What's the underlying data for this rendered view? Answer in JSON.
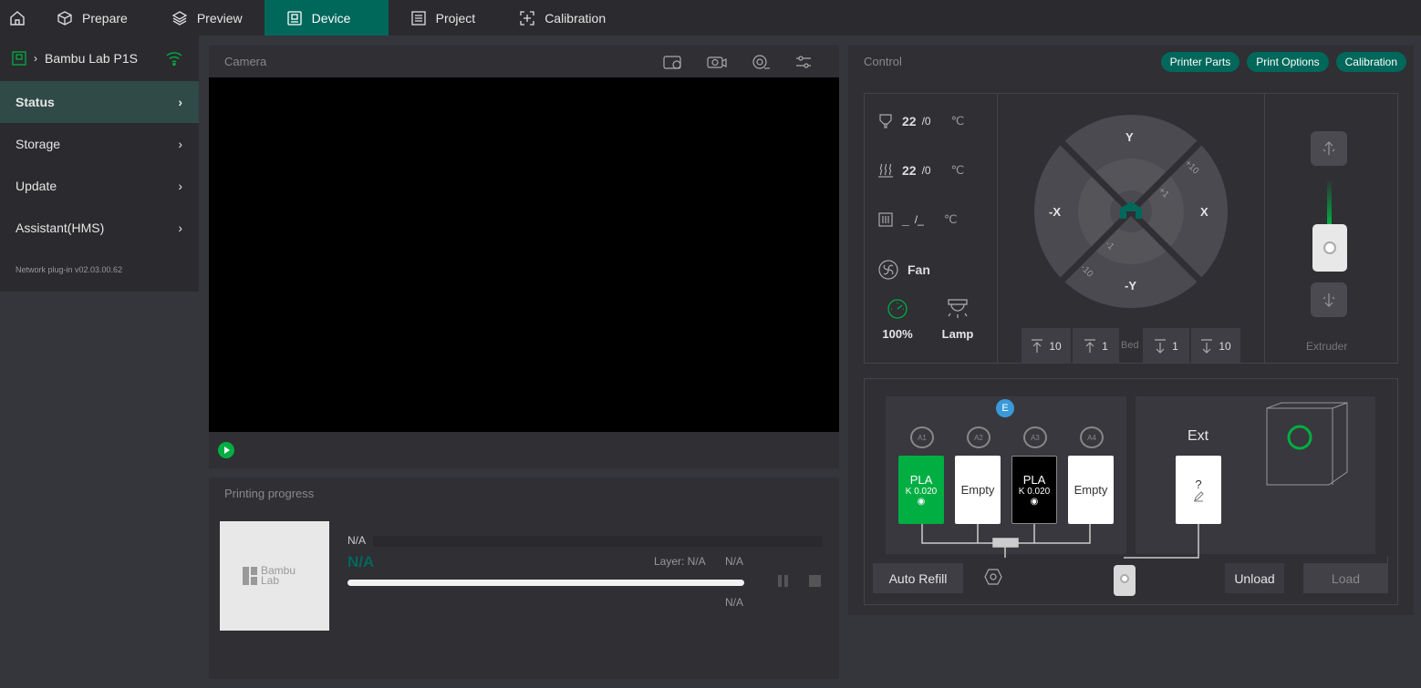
{
  "tabs": [
    {
      "label": "Prepare"
    },
    {
      "label": "Preview"
    },
    {
      "label": "Device"
    },
    {
      "label": "Project"
    },
    {
      "label": "Calibration"
    }
  ],
  "sidebar": {
    "device_name": "Bambu Lab P1S",
    "items": [
      {
        "label": "Status"
      },
      {
        "label": "Storage"
      },
      {
        "label": "Update"
      },
      {
        "label": "Assistant(HMS)"
      }
    ],
    "plugin_version": "Network plug-in v02.03.00.62"
  },
  "camera": {
    "title": "Camera"
  },
  "progress": {
    "title": "Printing progress",
    "thumbnail_text": "Bambu Lab",
    "name": "N/A",
    "status": "N/A",
    "layer": "Layer: N/A",
    "layer_value": "N/A",
    "time": "N/A",
    "percent": 0
  },
  "control": {
    "title": "Control",
    "buttons": {
      "printer_parts": "Printer Parts",
      "print_options": "Print Options",
      "calibration": "Calibration"
    },
    "nozzle": {
      "current": "22",
      "target": "/0",
      "unit": "℃"
    },
    "bed": {
      "current": "22",
      "target": "/0",
      "unit": "℃"
    },
    "chamber": {
      "current": "_",
      "target": "/_",
      "unit": "℃"
    },
    "fan_label": "Fan",
    "speed": "100%",
    "lamp": "Lamp",
    "jog": {
      "y": "Y",
      "neg_y": "-Y",
      "x": "X",
      "neg_x": "-X",
      "p10": "+10",
      "p1": "+1",
      "m1": "-1",
      "m10": "-10"
    },
    "z": {
      "up10": "10",
      "up1": "1",
      "bed": "Bed",
      "down1": "1",
      "down10": "10"
    },
    "extruder": "Extruder"
  },
  "ams": {
    "badge": "E",
    "slots": [
      {
        "id": "A1",
        "type": "PLA",
        "k": "K 0.020"
      },
      {
        "id": "A2",
        "type": "Empty"
      },
      {
        "id": "A3",
        "type": "PLA",
        "k": "K 0.020"
      },
      {
        "id": "A4",
        "type": "Empty"
      }
    ],
    "ext": {
      "label": "Ext",
      "value": "?"
    },
    "auto_refill": "Auto Refill",
    "unload": "Unload",
    "load": "Load"
  },
  "colors": {
    "accent": "#00675b",
    "green": "#00ae42"
  }
}
